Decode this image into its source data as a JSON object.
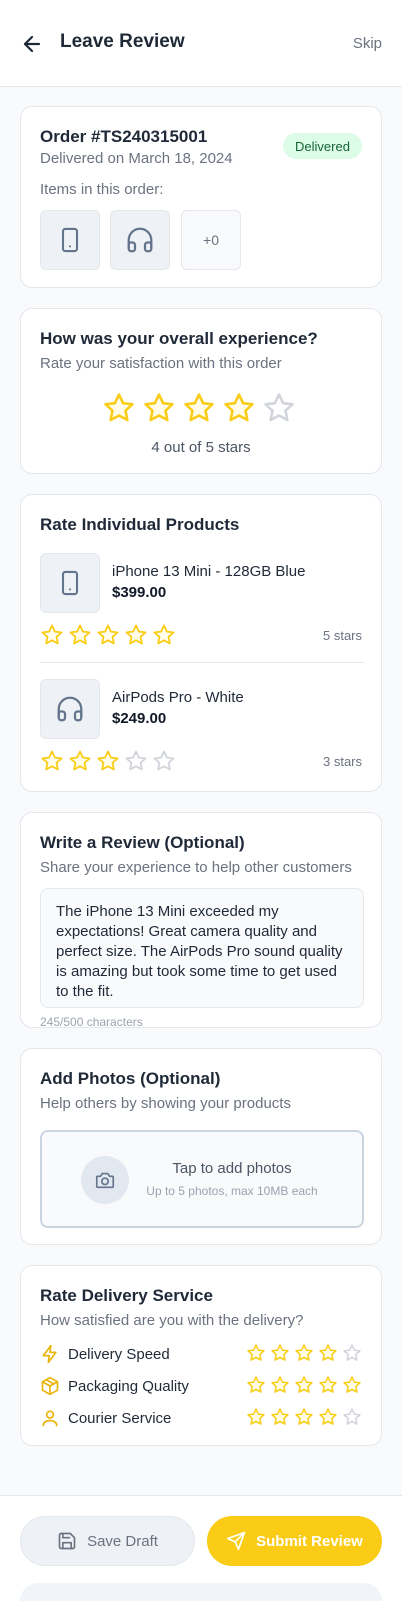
{
  "header": {
    "title": "Leave Review",
    "skip_label": "Skip"
  },
  "order": {
    "number": "Order #TS240315001",
    "delivered_on": "Delivered on March 18, 2024",
    "status": "Delivered",
    "items_label": "Items in this order:",
    "items": [
      {
        "icon": "phone-icon"
      },
      {
        "icon": "headphones-icon"
      }
    ],
    "more_label": "+0"
  },
  "overall": {
    "title": "How was your overall experience?",
    "subtitle": "Rate your satisfaction with this order",
    "rating": 4,
    "max": 5,
    "rating_text": "4 out of 5 stars"
  },
  "products": {
    "title": "Rate Individual Products",
    "items": [
      {
        "name": "iPhone 13 Mini - 128GB Blue",
        "price": "$399.00",
        "rating": 5,
        "rating_text": "5 stars",
        "icon": "phone-icon"
      },
      {
        "name": "AirPods Pro - White",
        "price": "$249.00",
        "rating": 3,
        "rating_text": "3 stars",
        "icon": "headphones-icon"
      }
    ]
  },
  "review": {
    "title": "Write a Review (Optional)",
    "subtitle": "Share your experience to help other customers",
    "text": "The iPhone 13 Mini exceeded my expectations! Great camera quality and perfect size. The AirPods Pro sound quality is amazing but took some time to get used to the fit.",
    "char_count": "245/500 characters"
  },
  "photos": {
    "title": "Add Photos (Optional)",
    "subtitle": "Help others by showing your products",
    "upload_title": "Tap to add photos",
    "upload_sub": "Up to 5 photos, max 10MB each"
  },
  "delivery": {
    "title": "Rate Delivery Service",
    "subtitle": "How satisfied are you with the delivery?",
    "items": [
      {
        "label": "Delivery Speed",
        "icon": "lightning-icon",
        "rating": 4
      },
      {
        "label": "Packaging Quality",
        "icon": "package-icon",
        "rating": 5
      },
      {
        "label": "Courier Service",
        "icon": "user-icon",
        "rating": 4
      }
    ]
  },
  "footer": {
    "save_label": "Save Draft",
    "submit_label": "Submit Review"
  },
  "colors": {
    "star_filled": "#facc15",
    "star_empty": "#d1d5db",
    "accent": "#facc15",
    "badge_bg": "#dcfce7",
    "badge_text": "#166534"
  }
}
